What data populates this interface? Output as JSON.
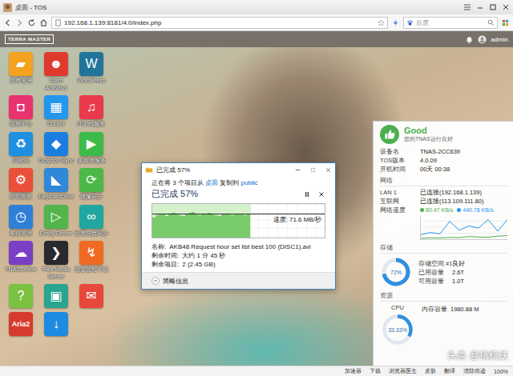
{
  "browser": {
    "title": "桌面 - TOS",
    "url": "192.168.1.139:8181/4.0/index.php",
    "search_placeholder": "百度",
    "status_items": [
      "加速器",
      "下载",
      "浏览器医生",
      "皮肤",
      "翻译",
      "清除痕迹",
      "100%"
    ]
  },
  "tos_bar": {
    "logo": "TERRA MASTER",
    "user": "admin"
  },
  "desktop_icons": [
    {
      "label": "文件管理",
      "glyph": "▰",
      "color": "#f4a21f"
    },
    {
      "label": "Clam Antivirus",
      "glyph": "☻",
      "color": "#e03a2f"
    },
    {
      "label": "WordPress",
      "glyph": "W",
      "color": "#21759b"
    },
    {
      "label": "应用中心",
      "glyph": "◘",
      "color": "#e8336f"
    },
    {
      "label": "Docker",
      "glyph": "▦",
      "color": "#2496ed"
    },
    {
      "label": "iTunes服务",
      "glyph": "♫",
      "color": "#e83a4a"
    },
    {
      "label": "回收站",
      "glyph": "♻",
      "color": "#1f8fe0"
    },
    {
      "label": "Dropbox Sync",
      "glyph": "◆",
      "color": "#1a7ee0"
    },
    {
      "label": "多媒体服务",
      "glyph": "▶",
      "color": "#3dbb4a"
    },
    {
      "label": "控制面板",
      "glyph": "⚙",
      "color": "#e94f3a"
    },
    {
      "label": "ElephantDrive",
      "glyph": "◣",
      "color": "#2f88d8"
    },
    {
      "label": "镜像同步",
      "glyph": "⟳",
      "color": "#4cb848"
    },
    {
      "label": "备份管理",
      "glyph": "◷",
      "color": "#2f7fd8"
    },
    {
      "label": "Emby Server",
      "glyph": "▷",
      "color": "#52b54b"
    },
    {
      "label": "百度云盘同步",
      "glyph": "∞",
      "color": "#22a6a0"
    },
    {
      "label": "TNAS.online",
      "glyph": "☁",
      "color": "#7b3fc4"
    },
    {
      "label": "Plex Media Server",
      "glyph": "❯",
      "color": "#282a2d"
    },
    {
      "label": "迅雷远程下载",
      "glyph": "↯",
      "color": "#f06a24"
    },
    {
      "glyph": "?",
      "color": "#7cc242"
    },
    {
      "glyph": "▣",
      "color": "#2aa58f"
    },
    {
      "glyph": "✉",
      "color": "#e8473b"
    },
    {
      "glyph": "Aria2",
      "color": "#d43b2e"
    },
    {
      "glyph": "↓",
      "color": "#1f8be0"
    }
  ],
  "copy_dialog": {
    "title": "已完成 57%",
    "summary": {
      "prefix": "正在将 3 个项目从 ",
      "source": "桌面",
      "middle": " 复制到 ",
      "target": "public"
    },
    "progress_label": "已完成 57%",
    "level": 0.57,
    "speed": "速度: 71.6 MB/秒",
    "speed_values": [
      62,
      70,
      74,
      72,
      68,
      75,
      78,
      73,
      70,
      66,
      72,
      76,
      80,
      74,
      69,
      71,
      75,
      77,
      73,
      70,
      68,
      72,
      74,
      71,
      69,
      73,
      75,
      72,
      70,
      71.6
    ],
    "details": [
      {
        "label": "名称:",
        "value": "AKB48 Request hour set list best 100 (DISC1).avi"
      },
      {
        "label": "剩余时间:",
        "value": "大约 1 分 45 秒"
      },
      {
        "label": "剩余项目:",
        "value": "2 (2.45 GB)"
      }
    ],
    "toggle": "简略信息"
  },
  "status_panel": {
    "health": "Good",
    "health_text": "您的TNAS运行良好",
    "info": [
      {
        "label": "设备名",
        "value": "TNAS-2CC639"
      },
      {
        "label": "TOS版本",
        "value": "4.0.09"
      },
      {
        "label": "开机时间",
        "value": "00天 00:38"
      }
    ],
    "network": {
      "title": "网络",
      "rows": [
        {
          "label": "LAN 1",
          "value": "已连接(192.168.1.139)"
        },
        {
          "label": "互联网",
          "value": "已连接(113.109.111.80)"
        }
      ],
      "speed_label": "网络速度",
      "series": [
        {
          "reading": "80.47 KB/s",
          "color": "#4caf50",
          "values": [
            20,
            30,
            25,
            40,
            35,
            60,
            50,
            45,
            70,
            80.47
          ]
        },
        {
          "reading": "440.78 KB/s",
          "color": "#2196f3",
          "values": [
            100,
            150,
            120,
            400,
            200,
            300,
            250,
            440,
            180,
            440.78
          ]
        }
      ]
    },
    "storage": {
      "title": "存储",
      "level": 0.72,
      "reading": "72%",
      "rows": [
        {
          "label": "存储空间 #1",
          "value": "良好"
        },
        {
          "label": "已用容量",
          "value": "2.6T"
        },
        {
          "label": "可用容量",
          "value": "1.0T"
        }
      ]
    },
    "resources": {
      "title": "资源",
      "cpu_label": "CPU",
      "cpu_level": 0.3333,
      "cpu_reading": "33.33%",
      "memory_label": "内存容量",
      "memory_value": "1980.88 M"
    }
  },
  "watermark": "头条 @搞机侠"
}
